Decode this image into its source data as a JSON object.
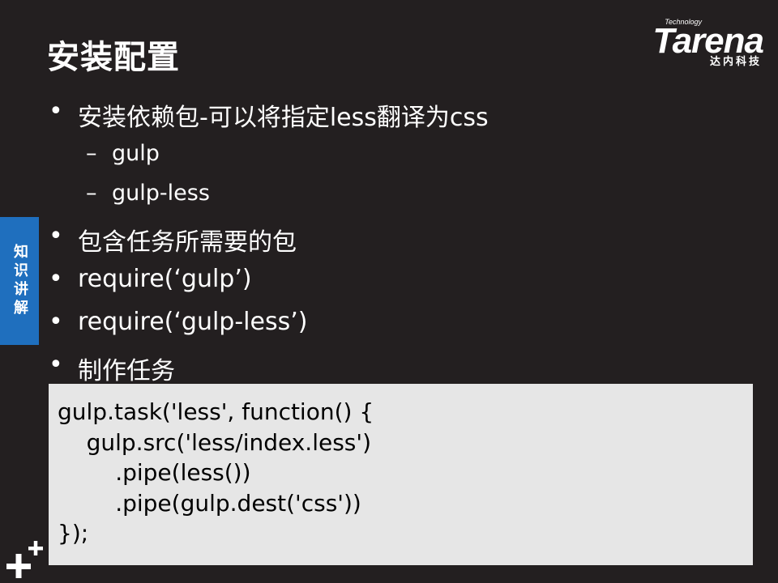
{
  "slide": {
    "title": "安装配置",
    "side_tab": "知识讲解",
    "logo": {
      "tech": "Technology",
      "main": "Tarena",
      "sub": "达内科技"
    },
    "bullets": [
      {
        "dot": "•",
        "text": "安装依赖包-可以将指定less翻译为css"
      },
      {
        "dot": "•",
        "text": "包含任务所需要的包"
      },
      {
        "dot": "•",
        "text": "require(‘gulp’)"
      },
      {
        "dot": "•",
        "text": "require(‘gulp-less’)"
      },
      {
        "dot": "•",
        "text": "制作任务"
      }
    ],
    "sub_items": [
      {
        "dash": "–",
        "text": "gulp"
      },
      {
        "dash": "–",
        "text": "gulp-less"
      }
    ],
    "code_lines": [
      "gulp.task('less', function() {",
      "    gulp.src('less/index.less')",
      "        .pipe(less())",
      "        .pipe(gulp.dest('css'))",
      "});"
    ]
  }
}
